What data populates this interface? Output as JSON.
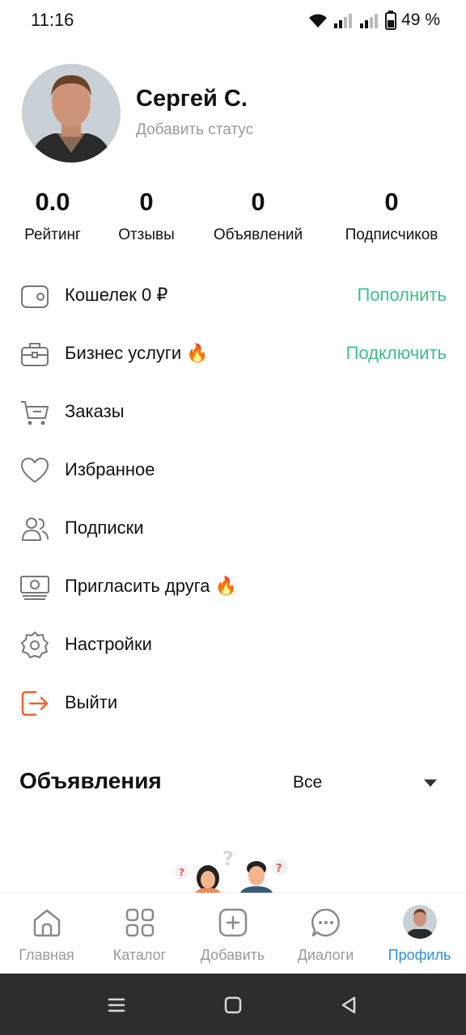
{
  "status_bar": {
    "time": "11:16",
    "battery": "49 %"
  },
  "profile": {
    "name": "Сергей С.",
    "status_placeholder": "Добавить статус"
  },
  "stats": [
    {
      "value": "0.0",
      "label": "Рейтинг"
    },
    {
      "value": "0",
      "label": "Отзывы"
    },
    {
      "value": "0",
      "label": "Объявлений"
    },
    {
      "value": "0",
      "label": "Подписчиков"
    }
  ],
  "menu": {
    "wallet": {
      "label": "Кошелек 0 ₽",
      "action": "Пополнить",
      "icon": "wallet-icon"
    },
    "business": {
      "label": "Бизнес услуги 🔥",
      "action": "Подключить",
      "icon": "briefcase-icon"
    },
    "orders": {
      "label": "Заказы",
      "icon": "cart-icon"
    },
    "favorites": {
      "label": "Избранное",
      "icon": "heart-icon"
    },
    "subscriptions": {
      "label": "Подписки",
      "icon": "users-icon"
    },
    "invite": {
      "label": "Пригласить друга 🔥",
      "icon": "money-icon"
    },
    "settings": {
      "label": "Настройки",
      "icon": "gear-icon"
    },
    "logout": {
      "label": "Выйти",
      "icon": "logout-icon"
    }
  },
  "ads": {
    "title": "Объявления",
    "filter_value": "Все"
  },
  "bottom_nav": {
    "home": "Главная",
    "catalog": "Каталог",
    "add": "Добавить",
    "dialogs": "Диалоги",
    "profile": "Профиль"
  },
  "colors": {
    "accent_green": "#3dbf8a",
    "active_blue": "#2a8fd8",
    "logout_orange": "#f0622d",
    "muted_gray": "#9a9a9a"
  }
}
